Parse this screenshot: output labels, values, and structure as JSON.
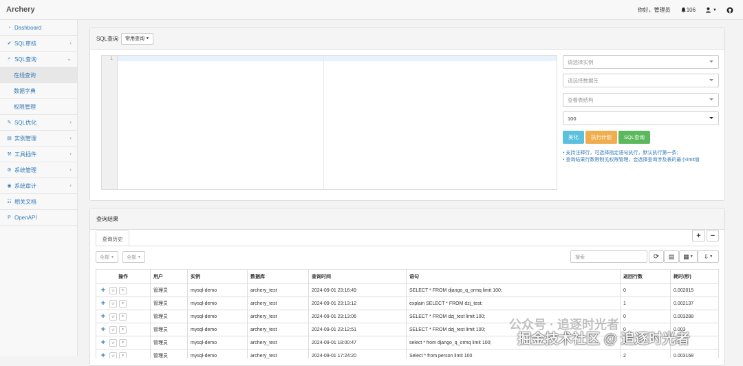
{
  "app": {
    "brand": "Archery"
  },
  "topbar": {
    "greeting": "你好，管理员",
    "notifications": "106"
  },
  "sidebar": {
    "items": [
      {
        "label": "Dashboard"
      },
      {
        "label": "SQL审核"
      },
      {
        "label": "SQL查询"
      },
      {
        "label": "在线查询"
      },
      {
        "label": "数据字典"
      },
      {
        "label": "权限管理"
      },
      {
        "label": "SQL优化"
      },
      {
        "label": "实例管理"
      },
      {
        "label": "工具插件"
      },
      {
        "label": "系统管理"
      },
      {
        "label": "系统审计"
      },
      {
        "label": "相关文档"
      },
      {
        "label": "OpenAPI"
      }
    ]
  },
  "query_panel": {
    "title": "SQL查询",
    "common_query": "常用查询",
    "editor_line": "1",
    "instance_placeholder": "请选择实例",
    "database_placeholder": "请选择数据库",
    "table_placeholder": "查看表结构",
    "limit_value": "100",
    "btn_beautify": "美化",
    "btn_explain": "执行计划",
    "btn_query": "SQL查询",
    "tip1": "支持注释行，可选择指定语句执行，默认执行第一条;",
    "tip2": "查询结果行数限制见权限管理，会选择查询涉及表的最小limit值"
  },
  "results_panel": {
    "title": "查询结果",
    "tab_history": "查询历史",
    "filter_all_1": "全部",
    "filter_all_2": "全部",
    "search_placeholder": "搜索",
    "columns": [
      "操作",
      "用户",
      "实例",
      "数据库",
      "查询时间",
      "语句",
      "返回行数",
      "耗时(秒)"
    ],
    "rows": [
      {
        "user": "管理员",
        "instance": "mysql-demo",
        "db": "archery_test",
        "time": "2024-09-01 23:16:49",
        "sql": "SELECT * FROM django_q_ormq limit 100;",
        "rows": "0",
        "cost": "0.002015"
      },
      {
        "user": "管理员",
        "instance": "mysql-demo",
        "db": "archery_test",
        "time": "2024-09-01 23:13:12",
        "sql": "explain SELECT * FROM dzj_test;",
        "rows": "1",
        "cost": "0.002137"
      },
      {
        "user": "管理员",
        "instance": "mysql-demo",
        "db": "archery_test",
        "time": "2024-09-01 23:13:06",
        "sql": "SELECT * FROM dzj_test limit 100;",
        "rows": "0",
        "cost": "0.003288"
      },
      {
        "user": "管理员",
        "instance": "mysql-demo",
        "db": "archery_test",
        "time": "2024-09-01 23:12:51",
        "sql": "SELECT * FROM dzj_test limit 100;",
        "rows": "0",
        "cost": "0.003"
      },
      {
        "user": "管理员",
        "instance": "mysql-demo",
        "db": "archery_test",
        "time": "2024-09-01 18:00:47",
        "sql": "select * from django_q_ormq limit 100;",
        "rows": "0",
        "cost": "0.0025"
      },
      {
        "user": "管理员",
        "instance": "mysql-demo",
        "db": "archery_test",
        "time": "2024-09-01 17:24:20",
        "sql": "Select * from person limit 100",
        "rows": "2",
        "cost": "0.003168"
      }
    ]
  },
  "watermark": {
    "line1": "公众号 · 追逐时光者",
    "line2": "掘金技术社区 @ 追逐时光者"
  },
  "colors": {
    "beautify": "#5bc0de",
    "explain": "#f0ad4e",
    "query": "#5cb85c",
    "link": "#337ab7"
  }
}
